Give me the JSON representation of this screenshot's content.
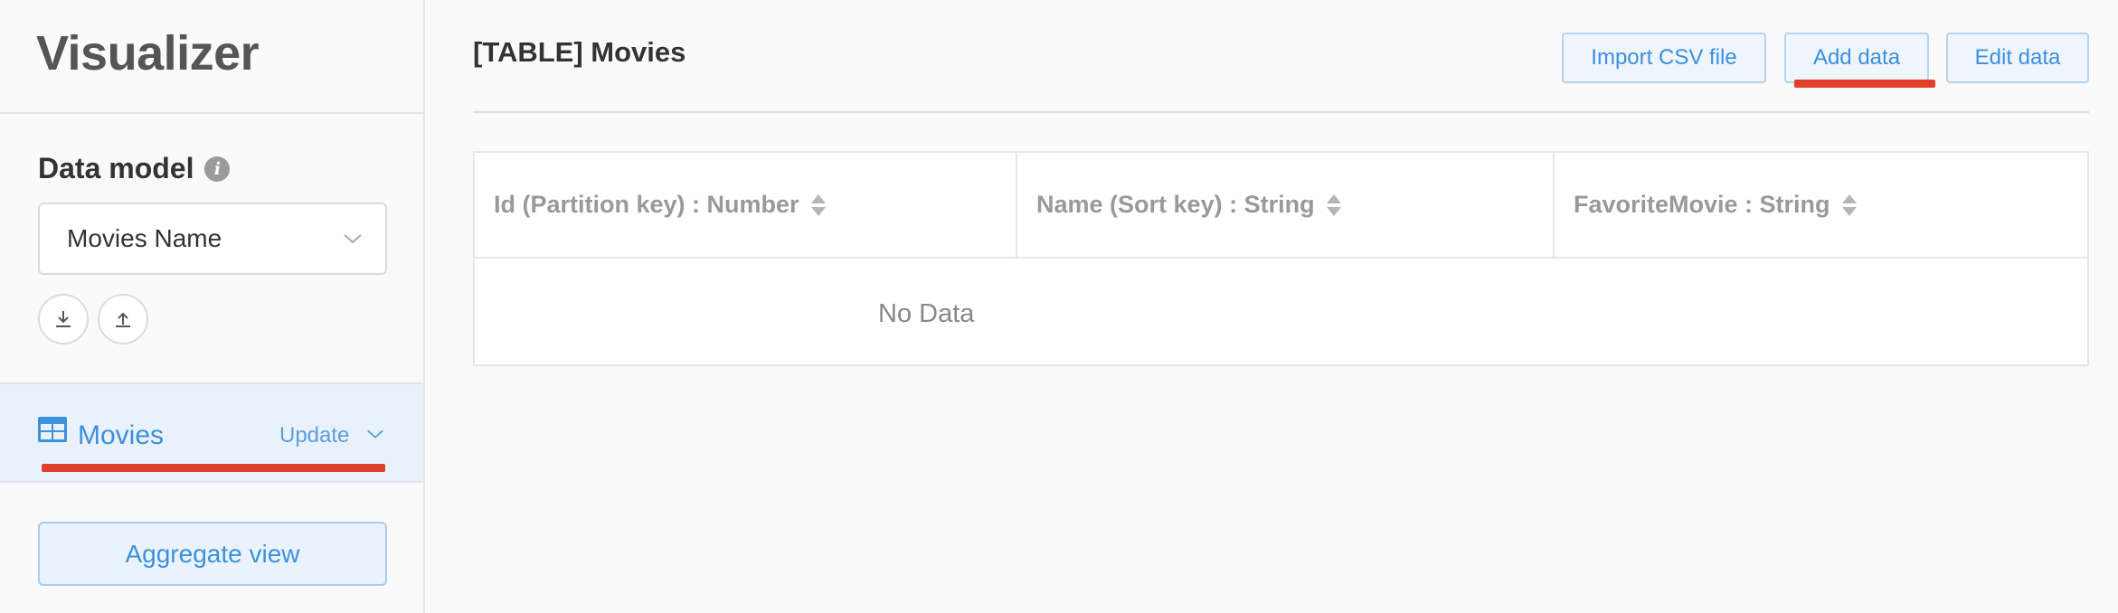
{
  "sidebar": {
    "app_title": "Visualizer",
    "data_model_heading": "Data model",
    "info_icon": "i",
    "model_select_value": "Movies Name",
    "tables": [
      {
        "name": "Movies",
        "action_label": "Update"
      }
    ],
    "aggregate_view_label": "Aggregate view"
  },
  "main": {
    "title": "[TABLE] Movies",
    "buttons": {
      "import_csv": "Import CSV file",
      "add_data": "Add data",
      "edit_data": "Edit data"
    },
    "table": {
      "columns": [
        "Id (Partition key) : Number",
        "Name (Sort key) : String",
        "FavoriteMovie : String"
      ],
      "empty_text": "No Data"
    }
  },
  "colors": {
    "accent": "#3d8fe0",
    "highlight": "#e0402a",
    "selected_bg": "#e9f2fc"
  }
}
